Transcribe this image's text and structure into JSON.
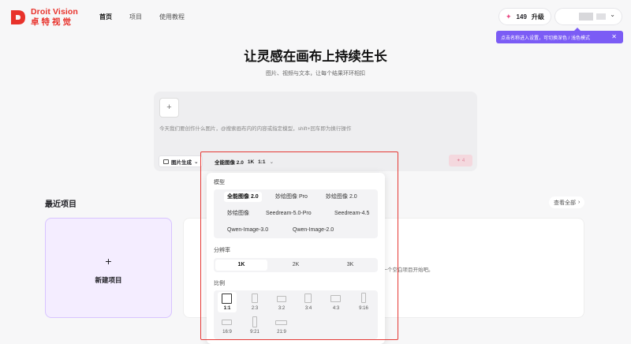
{
  "brand": {
    "name_en": "Droit Vision",
    "name_cn": "卓特视觉",
    "accent": "#e8322b"
  },
  "nav": {
    "home": "首页",
    "projects": "项目",
    "tutorial": "使用教程"
  },
  "header": {
    "credits": "149",
    "upgrade": "升级"
  },
  "toast": {
    "text": "点击名称进入设置，可切换深色 / 浅色模式",
    "close": "✕",
    "color": "#7b5cf5"
  },
  "hero": {
    "title": "让灵感在画布上持续生长",
    "subtitle": "图片、视频与文本，让每个结果环环相扣"
  },
  "composer": {
    "upload": "+",
    "placeholder": "今天我们要创作什么图片，@搜索画布内的内容或指定模型，shift+回车即为换行操作",
    "mode": "图片生成",
    "params": {
      "model": "全能图像 2.0",
      "resolution": "1K",
      "ratio": "1:1"
    },
    "send_count": "4"
  },
  "recent": {
    "title": "最近项目",
    "view_all": "查看全部",
    "new_project": "新建项目",
    "empty_text": "建一个空白项目开始吧。"
  },
  "panel": {
    "model_label": "模型",
    "models": [
      "全能图像 2.0",
      "妙绘图像 Pro",
      "妙绘图像 2.0",
      "妙绘图像",
      "Seedream-5.0-Pro",
      "Seedream-4.5",
      "Qwen-Image-3.0",
      "Qwen-Image-2.0"
    ],
    "selected_model": "全能图像 2.0",
    "resolution_label": "分辨率",
    "resolutions": [
      "1K",
      "2K",
      "3K"
    ],
    "selected_resolution": "1K",
    "ratio_label": "比例",
    "ratios": [
      "1:1",
      "2:3",
      "3:2",
      "3:4",
      "4:3",
      "9:16",
      "16:9",
      "9:21",
      "21:9"
    ],
    "selected_ratio": "1:1"
  }
}
